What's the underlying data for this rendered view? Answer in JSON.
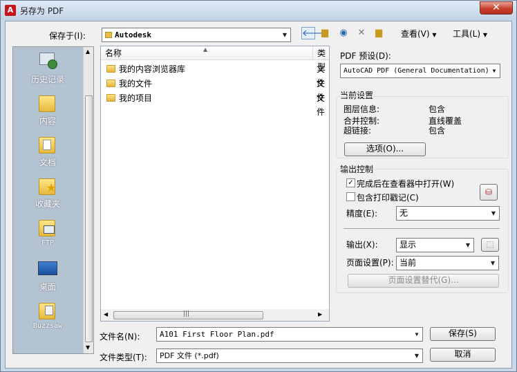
{
  "window": {
    "title": "另存为 PDF",
    "close_label": "✕"
  },
  "toolbar": {
    "save_in_label": "保存于(I):",
    "save_in_value": "Autodesk",
    "view_label": "查看(V)",
    "tools_label": "工具(L)"
  },
  "places": [
    {
      "label": "历史记录",
      "icon": "history-icon"
    },
    {
      "label": "内容",
      "icon": "folder-icon"
    },
    {
      "label": "文档",
      "icon": "documents-icon"
    },
    {
      "label": "收藏夹",
      "icon": "favorites-icon"
    },
    {
      "label": "FTP",
      "icon": "ftp-icon"
    },
    {
      "label": "桌面",
      "icon": "desktop-icon"
    },
    {
      "label": "Buzzsaw",
      "icon": "buzzsaw-icon"
    }
  ],
  "filelist": {
    "columns": [
      "名称",
      "类型"
    ],
    "rows": [
      {
        "name": "我的内容浏览器库",
        "type": "文件"
      },
      {
        "name": "我的文件",
        "type": "文件"
      },
      {
        "name": "我的项目",
        "type": "文件"
      }
    ]
  },
  "filename": {
    "label": "文件名(N):",
    "value": "A101 First Floor Plan.pdf"
  },
  "filetype": {
    "label": "文件类型(T):",
    "value": "PDF 文件 (*.pdf)"
  },
  "buttons": {
    "save": "保存(S)",
    "cancel": "取消"
  },
  "pdf": {
    "preset_label": "PDF 预设(D):",
    "preset_value": "AutoCAD PDF (General Documentation)",
    "current_settings_title": "当前设置",
    "settings": [
      {
        "key": "图层信息:",
        "value": "包含"
      },
      {
        "key": "合并控制:",
        "value": "直线覆盖"
      },
      {
        "key": "超链接:",
        "value": "包含"
      }
    ],
    "options_button": "选项(O)...",
    "output_control_title": "输出控制",
    "open_in_viewer_label": "完成后在查看器中打开(W)",
    "open_in_viewer_checked": true,
    "include_plot_stamp_label": "包含打印戳记(C)",
    "include_plot_stamp_checked": false,
    "precision_label": "精度(E):",
    "precision_value": "无",
    "output_label": "输出(X):",
    "output_value": "显示",
    "page_setup_label": "页面设置(P):",
    "page_setup_value": "当前",
    "page_setup_override_button": "页面设置替代(G)..."
  }
}
